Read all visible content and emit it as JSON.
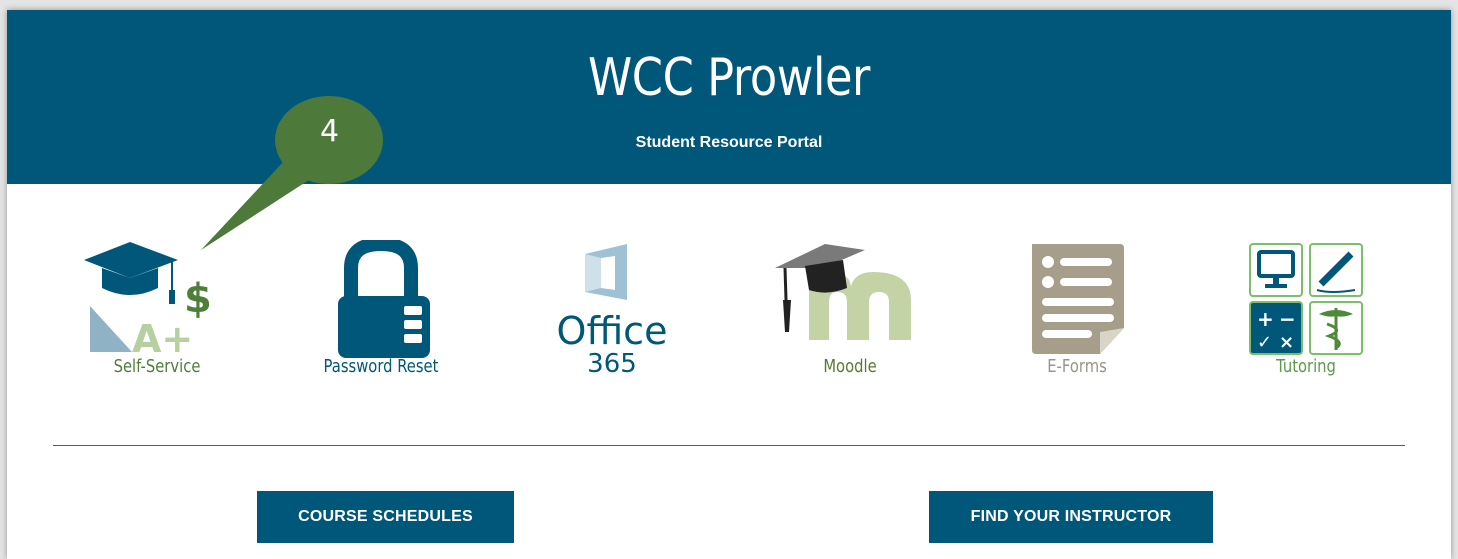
{
  "header": {
    "title": "WCC Prowler",
    "subtitle": "Student Resource Portal",
    "background": "#005779"
  },
  "tiles": [
    {
      "label": "Self-Service",
      "icon": "graduation-cap-dollar-a-plus-icon",
      "label_color": "#4f7d3a"
    },
    {
      "label": "Password Reset",
      "icon": "padlock-icon",
      "label_color": "#005779"
    },
    {
      "label": "Office\n365",
      "icon": "office-365-icon",
      "label_color": "#005779"
    },
    {
      "label": "Moodle",
      "icon": "moodle-icon",
      "label_color": "#5a7a2e"
    },
    {
      "label": "E-Forms",
      "icon": "form-document-icon",
      "label_color": "#9a9488"
    },
    {
      "label": "Tutoring",
      "icon": "tutoring-grid-icon",
      "label_color": "#5a9a4a"
    }
  ],
  "office_text": {
    "line1": "Office",
    "line2": "365"
  },
  "buttons": {
    "course_schedules": "COURSE SCHEDULES",
    "find_instructor": "FIND YOUR INSTRUCTOR"
  },
  "callout": {
    "number": "4",
    "color": "#4d7a3b"
  }
}
